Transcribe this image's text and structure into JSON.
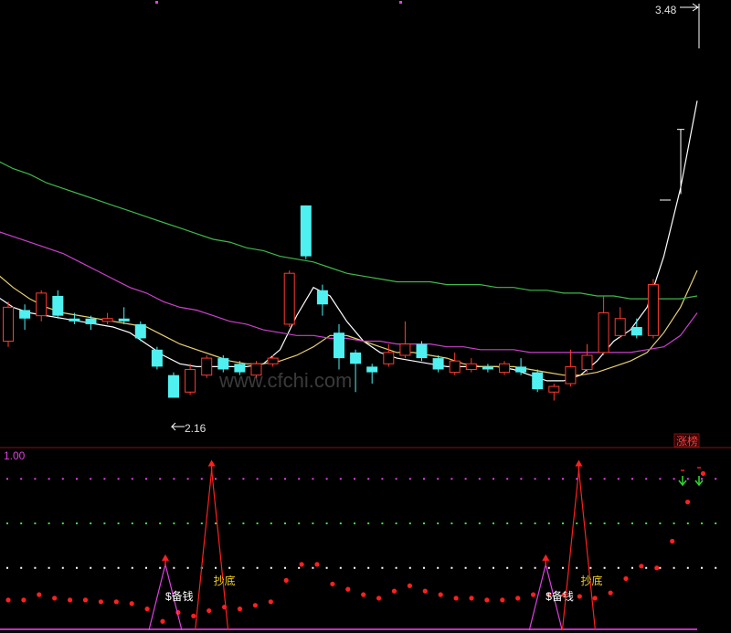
{
  "chart_data": {
    "type": "candlestick",
    "main": {
      "ylim": [
        2.0,
        3.55
      ],
      "max_label": "3.48",
      "min_label": "2.16",
      "watermark": "www.cfchi.com",
      "limit_up_tag": "涨榜",
      "up_color": "#ff3b30",
      "down_color": "#4ff0f0",
      "candles": [
        {
          "o": 2.36,
          "c": 2.48,
          "h": 2.5,
          "l": 2.34
        },
        {
          "o": 2.47,
          "c": 2.44,
          "h": 2.49,
          "l": 2.4
        },
        {
          "o": 2.45,
          "c": 2.53,
          "h": 2.54,
          "l": 2.43
        },
        {
          "o": 2.52,
          "c": 2.45,
          "h": 2.54,
          "l": 2.44
        },
        {
          "o": 2.44,
          "c": 2.43,
          "h": 2.46,
          "l": 2.42
        },
        {
          "o": 2.44,
          "c": 2.42,
          "h": 2.45,
          "l": 2.4
        },
        {
          "o": 2.43,
          "c": 2.44,
          "h": 2.46,
          "l": 2.42
        },
        {
          "o": 2.44,
          "c": 2.43,
          "h": 2.48,
          "l": 2.42
        },
        {
          "o": 2.42,
          "c": 2.37,
          "h": 2.43,
          "l": 2.36
        },
        {
          "o": 2.33,
          "c": 2.27,
          "h": 2.34,
          "l": 2.26
        },
        {
          "o": 2.24,
          "c": 2.16,
          "h": 2.25,
          "l": 2.16
        },
        {
          "o": 2.18,
          "c": 2.26,
          "h": 2.28,
          "l": 2.17
        },
        {
          "o": 2.24,
          "c": 2.3,
          "h": 2.31,
          "l": 2.23
        },
        {
          "o": 2.3,
          "c": 2.26,
          "h": 2.31,
          "l": 2.25
        },
        {
          "o": 2.28,
          "c": 2.25,
          "h": 2.29,
          "l": 2.24
        },
        {
          "o": 2.24,
          "c": 2.28,
          "h": 2.29,
          "l": 2.23
        },
        {
          "o": 2.28,
          "c": 2.3,
          "h": 2.31,
          "l": 2.27
        },
        {
          "o": 2.42,
          "c": 2.6,
          "h": 2.61,
          "l": 2.41
        },
        {
          "o": 2.84,
          "c": 2.66,
          "h": 2.84,
          "l": 2.65
        },
        {
          "o": 2.54,
          "c": 2.49,
          "h": 2.56,
          "l": 2.45
        },
        {
          "o": 2.39,
          "c": 2.3,
          "h": 2.42,
          "l": 2.26
        },
        {
          "o": 2.32,
          "c": 2.28,
          "h": 2.33,
          "l": 2.18
        },
        {
          "o": 2.27,
          "c": 2.25,
          "h": 2.28,
          "l": 2.21
        },
        {
          "o": 2.28,
          "c": 2.32,
          "h": 2.35,
          "l": 2.27
        },
        {
          "o": 2.31,
          "c": 2.35,
          "h": 2.43,
          "l": 2.3
        },
        {
          "o": 2.35,
          "c": 2.3,
          "h": 2.36,
          "l": 2.29
        },
        {
          "o": 2.3,
          "c": 2.26,
          "h": 2.31,
          "l": 2.25
        },
        {
          "o": 2.25,
          "c": 2.29,
          "h": 2.32,
          "l": 2.24
        },
        {
          "o": 2.26,
          "c": 2.28,
          "h": 2.3,
          "l": 2.25
        },
        {
          "o": 2.27,
          "c": 2.26,
          "h": 2.28,
          "l": 2.25
        },
        {
          "o": 2.25,
          "c": 2.28,
          "h": 2.29,
          "l": 2.24
        },
        {
          "o": 2.27,
          "c": 2.25,
          "h": 2.3,
          "l": 2.24
        },
        {
          "o": 2.25,
          "c": 2.19,
          "h": 2.26,
          "l": 2.18
        },
        {
          "o": 2.18,
          "c": 2.2,
          "h": 2.21,
          "l": 2.15
        },
        {
          "o": 2.21,
          "c": 2.27,
          "h": 2.33,
          "l": 2.2
        },
        {
          "o": 2.26,
          "c": 2.31,
          "h": 2.35,
          "l": 2.25
        },
        {
          "o": 2.32,
          "c": 2.46,
          "h": 2.52,
          "l": 2.31
        },
        {
          "o": 2.38,
          "c": 2.44,
          "h": 2.48,
          "l": 2.37
        },
        {
          "o": 2.41,
          "c": 2.38,
          "h": 2.44,
          "l": 2.37
        },
        {
          "o": 2.38,
          "c": 2.56,
          "h": 2.58,
          "l": 2.37
        }
      ],
      "projection": {
        "h": 3.48,
        "l": 2.88
      },
      "ma_lines": [
        {
          "color": "#ffffff",
          "values": [
            2.52,
            2.48,
            2.46,
            2.45,
            2.44,
            2.43,
            2.42,
            2.41,
            2.39,
            2.35,
            2.31,
            2.28,
            2.27,
            2.27,
            2.27,
            2.27,
            2.28,
            2.33,
            2.45,
            2.55,
            2.52,
            2.43,
            2.36,
            2.32,
            2.3,
            2.29,
            2.28,
            2.27,
            2.27,
            2.27,
            2.27,
            2.26,
            2.24,
            2.22,
            2.22,
            2.24,
            2.29,
            2.36,
            2.4,
            2.48,
            2.66,
            2.9,
            3.21
          ]
        },
        {
          "color": "#e8d070",
          "values": [
            2.6,
            2.55,
            2.51,
            2.48,
            2.46,
            2.45,
            2.44,
            2.43,
            2.42,
            2.41,
            2.38,
            2.35,
            2.33,
            2.31,
            2.29,
            2.28,
            2.28,
            2.29,
            2.31,
            2.34,
            2.38,
            2.38,
            2.36,
            2.34,
            2.32,
            2.32,
            2.31,
            2.3,
            2.28,
            2.27,
            2.27,
            2.27,
            2.26,
            2.25,
            2.24,
            2.24,
            2.25,
            2.27,
            2.29,
            2.32,
            2.39,
            2.48,
            2.61
          ]
        },
        {
          "color": "#cc40cc",
          "values": [
            2.75,
            2.73,
            2.71,
            2.69,
            2.67,
            2.64,
            2.61,
            2.58,
            2.55,
            2.53,
            2.5,
            2.48,
            2.47,
            2.45,
            2.43,
            2.42,
            2.4,
            2.39,
            2.38,
            2.38,
            2.37,
            2.37,
            2.36,
            2.36,
            2.35,
            2.35,
            2.35,
            2.34,
            2.34,
            2.33,
            2.33,
            2.33,
            2.32,
            2.32,
            2.32,
            2.32,
            2.32,
            2.32,
            2.32,
            2.33,
            2.34,
            2.38,
            2.46
          ]
        },
        {
          "color": "#3fb84a",
          "values": [
            3.0,
            2.97,
            2.95,
            2.92,
            2.9,
            2.88,
            2.86,
            2.84,
            2.82,
            2.8,
            2.78,
            2.76,
            2.74,
            2.72,
            2.71,
            2.69,
            2.68,
            2.66,
            2.65,
            2.64,
            2.62,
            2.6,
            2.59,
            2.58,
            2.57,
            2.57,
            2.57,
            2.56,
            2.56,
            2.56,
            2.55,
            2.55,
            2.54,
            2.54,
            2.53,
            2.53,
            2.52,
            2.52,
            2.51,
            2.51,
            2.51,
            2.51,
            2.52
          ]
        }
      ]
    },
    "sub": {
      "ylim": [
        0,
        1.0
      ],
      "top_label": "1.00",
      "levels": [
        {
          "value": 0.85,
          "color": "#e040e0"
        },
        {
          "value": 0.6,
          "color": "#40e040"
        },
        {
          "value": 0.35,
          "color": "#ffffff"
        }
      ],
      "line_color": "#ff2020",
      "dots": [
        0.17,
        0.17,
        0.2,
        0.18,
        0.17,
        0.17,
        0.16,
        0.16,
        0.15,
        0.12,
        0.05,
        0.1,
        0.08,
        0.11,
        0.13,
        0.12,
        0.14,
        0.16,
        0.28,
        0.37,
        0.37,
        0.26,
        0.23,
        0.2,
        0.18,
        0.22,
        0.25,
        0.22,
        0.2,
        0.18,
        0.18,
        0.17,
        0.17,
        0.18,
        0.2,
        0.2,
        0.2,
        0.19,
        0.18,
        0.21,
        0.29,
        0.36,
        0.35,
        0.5,
        0.72,
        0.88
      ],
      "spikes": [
        {
          "x": 9.5,
          "peak": 0.37,
          "color": "#e040e0",
          "label": "$备钱"
        },
        {
          "x": 12.3,
          "peak": 0.9,
          "color": "#ff2020",
          "label": "抄底"
        },
        {
          "x": 32.5,
          "peak": 0.37,
          "color": "#e040e0",
          "label": "$备钱"
        },
        {
          "x": 34.5,
          "peak": 0.9,
          "color": "#ff2020",
          "label": "抄底"
        }
      ],
      "signals": [
        {
          "x": 41.5,
          "color": "#30d030"
        },
        {
          "x": 42.5,
          "color": "#30d030"
        }
      ]
    }
  }
}
